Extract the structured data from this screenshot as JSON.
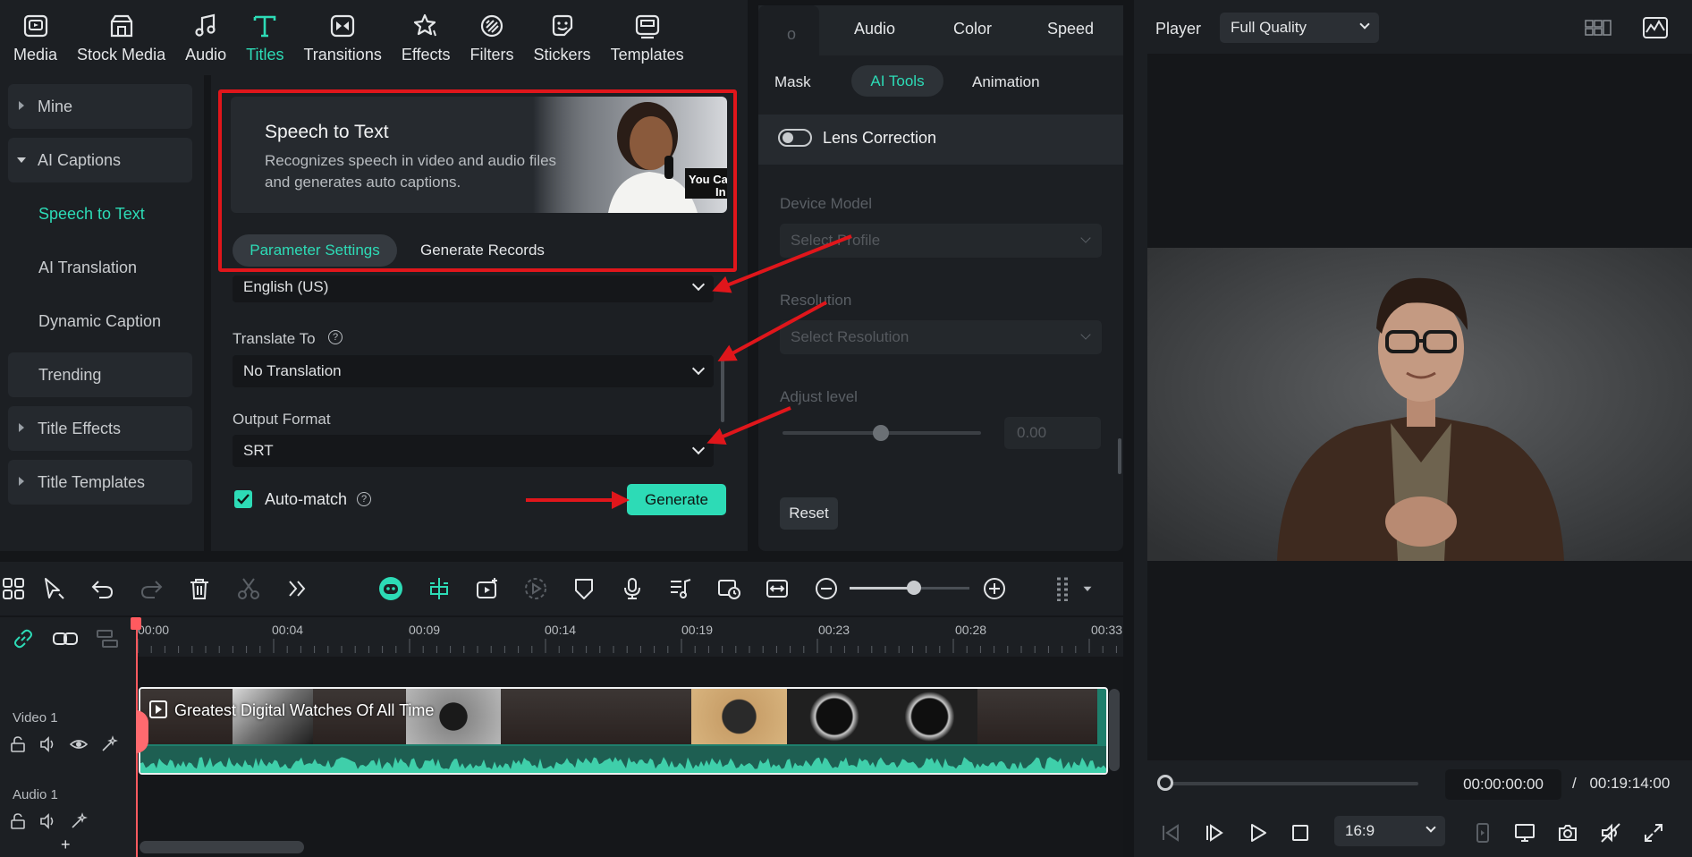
{
  "toolbar": {
    "tabs": [
      {
        "label": "Media",
        "icon": "media-icon"
      },
      {
        "label": "Stock Media",
        "icon": "stock-media-icon"
      },
      {
        "label": "Audio",
        "icon": "music-note-icon"
      },
      {
        "label": "Titles",
        "icon": "titles-t-icon",
        "active": true
      },
      {
        "label": "Transitions",
        "icon": "transitions-icon"
      },
      {
        "label": "Effects",
        "icon": "effects-star-icon"
      },
      {
        "label": "Filters",
        "icon": "filters-icon"
      },
      {
        "label": "Stickers",
        "icon": "stickers-icon"
      },
      {
        "label": "Templates",
        "icon": "templates-icon"
      }
    ]
  },
  "sidebar": {
    "items": [
      {
        "label": "Mine"
      },
      {
        "label": "AI Captions"
      },
      {
        "label": "Speech to Text"
      },
      {
        "label": "AI Translation"
      },
      {
        "label": "Dynamic Caption"
      },
      {
        "label": "Trending"
      },
      {
        "label": "Title Effects"
      },
      {
        "label": "Title Templates"
      }
    ]
  },
  "stt": {
    "title": "Speech to Text",
    "description": "Recognizes speech in video and audio files and generates auto captions.",
    "card_image_caption_1": "You Ca",
    "card_image_caption_2": "In",
    "tab_params": "Parameter Settings",
    "tab_records": "Generate Records",
    "language_value": "English (US)",
    "translate_label": "Translate To",
    "translate_value": "No Translation",
    "output_label": "Output Format",
    "output_value": "SRT",
    "automatch_label": "Auto-match",
    "automatch_checked": true,
    "generate_label": "Generate"
  },
  "properties": {
    "tabs": [
      "o",
      "Audio",
      "Color",
      "Speed"
    ],
    "subtabs": [
      "Mask",
      "AI Tools",
      "Animation"
    ],
    "lens_correction_label": "Lens Correction",
    "device_model_label": "Device Model",
    "device_model_placeholder": "Select Profile",
    "resolution_label": "Resolution",
    "resolution_placeholder": "Select Resolution",
    "adjust_level_label": "Adjust level",
    "adjust_level_value": "0.00",
    "reset_label": "Reset"
  },
  "player": {
    "label": "Player",
    "quality": "Full Quality",
    "current_time": "00:00:00:00",
    "separator": "/",
    "total_time": "00:19:14:00",
    "aspect_ratio": "16:9"
  },
  "timeline": {
    "ruler_ticks": [
      "00:00",
      "00:04",
      "00:09",
      "00:14",
      "00:19",
      "00:23",
      "00:28",
      "00:33"
    ],
    "video_track_label": "Video 1",
    "audio_track_label": "Audio 1",
    "clip_title": "Greatest Digital Watches Of All Time",
    "add_track": "+"
  },
  "colors": {
    "accent": "#2ddbb6",
    "annotation_red": "#e0161b",
    "panel_bg": "#1c1f23"
  }
}
